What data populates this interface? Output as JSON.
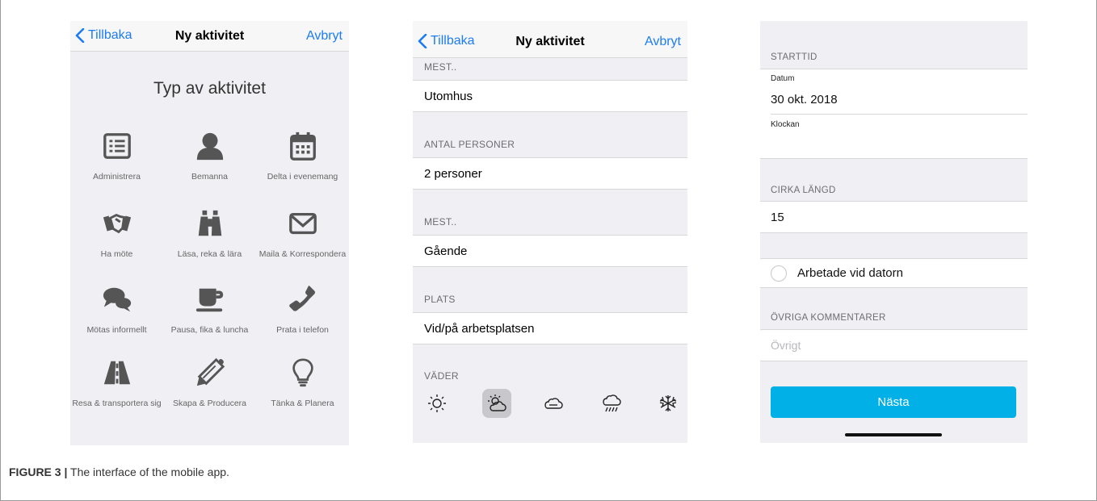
{
  "nav": {
    "back": "Tillbaka",
    "title": "Ny aktivitet",
    "cancel": "Avbryt"
  },
  "screen1": {
    "heading": "Typ av aktivitet",
    "tiles": [
      {
        "label": "Administrera",
        "icon": "list-icon"
      },
      {
        "label": "Bemanna",
        "icon": "person-icon"
      },
      {
        "label": "Delta i evenemang",
        "icon": "calendar-icon"
      },
      {
        "label": "Ha möte",
        "icon": "handshake-icon"
      },
      {
        "label": "Läsa, reka & lära",
        "icon": "binoculars-icon"
      },
      {
        "label": "Maila & Korrespondera",
        "icon": "envelope-icon"
      },
      {
        "label": "Mötas informellt",
        "icon": "chat-bubbles-icon"
      },
      {
        "label": "Pausa, fika & luncha",
        "icon": "coffee-cup-icon"
      },
      {
        "label": "Prata i telefon",
        "icon": "phone-icon"
      },
      {
        "label": "Resa & transportera sig",
        "icon": "road-icon"
      },
      {
        "label": "Skapa & Producera",
        "icon": "pencil-icon"
      },
      {
        "label": "Tänka & Planera",
        "icon": "lightbulb-icon"
      }
    ]
  },
  "screen2": {
    "sections": [
      {
        "header": "MEST..",
        "value": "Utomhus"
      },
      {
        "header": "ANTAL PERSONER",
        "value": "2 personer"
      },
      {
        "header": "MEST..",
        "value": "Gående"
      },
      {
        "header": "PLATS",
        "value": "Vid/på arbetsplatsen"
      }
    ],
    "weather_header": "VÄDER",
    "weather_icons": [
      "sun-icon",
      "partly-cloudy-icon",
      "cloud-icon",
      "rain-icon",
      "snowflake-icon"
    ],
    "weather_selected": "partly-cloudy-icon"
  },
  "screen3": {
    "start_header": "STARTTID",
    "date_label": "Datum",
    "date_value": "30 okt. 2018",
    "time_label": "Klockan",
    "length_header": "CIRKA LÄNGD",
    "length_value": "15",
    "checkbox_label": "Arbetade vid datorn",
    "comments_header": "ÖVRIGA KOMMENTARER",
    "comments_placeholder": "Övrigt",
    "next_button": "Nästa"
  },
  "caption": {
    "label": "FIGURE 3 |",
    "text": "The interface of the mobile app."
  },
  "colors": {
    "link": "#1c7cf3",
    "button": "#00b0e6",
    "background": "#efeff4"
  }
}
